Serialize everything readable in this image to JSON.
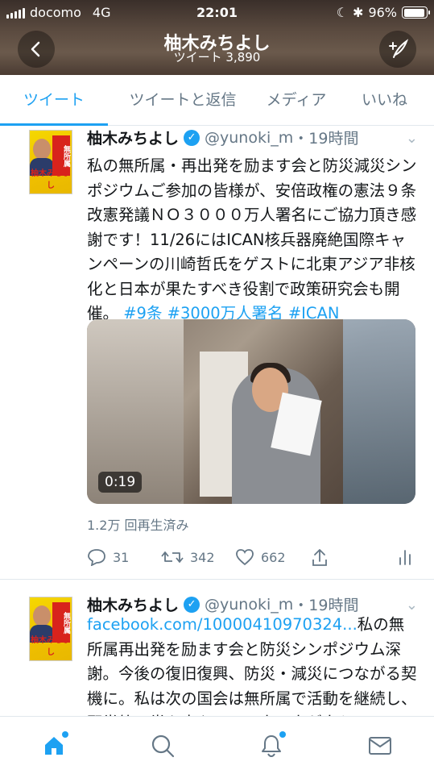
{
  "status_bar": {
    "carrier": "docomo",
    "network": "4G",
    "time": "22:01",
    "battery": "96%",
    "battery_level": 0.96
  },
  "profile_header": {
    "name": "柚木みちよし",
    "tweet_count": "ツイート 3,890"
  },
  "tabs": [
    {
      "label": "ツイート",
      "active": true
    },
    {
      "label": "ツイートと返信",
      "active": false
    },
    {
      "label": "メディア",
      "active": false
    },
    {
      "label": "いいね",
      "active": false
    }
  ],
  "tweets": [
    {
      "avatar": {
        "badge_text": "無所属",
        "name_text": "柚木みちよし"
      },
      "author": "柚木みちよし",
      "handle": "@yunoki_m",
      "time": "・19時間",
      "text": "私の無所属・再出発を励ます会と防災減災シンポジウムご参加の皆様が、安倍政権の憲法９条改憲発議ＮＯ３０００万人署名にご協力頂き感謝です！11/26にはICAN核兵器廃絶国際キャンペーンの川崎哲氏をゲストに北東アジア非核化と日本が果たすべき役割で政策研究会も開催。",
      "hashtags": [
        " #9条",
        " #3000万人署名",
        " #ICAN"
      ],
      "video_duration": "0:19",
      "views": "1.2万 回再生済み",
      "replies": "31",
      "retweets": "342",
      "likes": "662"
    },
    {
      "author": "柚木みちよし",
      "handle": "@yunoki_m",
      "time": "・19時間",
      "link": "facebook.com/10000410970324...",
      "text": "私の無所属再出発を励ます会と防災シンポジウム深謝。今後の復旧復興、防災・減災につながる契機に。私は次の国会は無所属で活動を継続し、野党第一党を中心に、一人一人が自らの"
    }
  ],
  "bottom_nav": {
    "items": [
      "home-icon",
      "search-icon",
      "notifications-icon",
      "messages-icon"
    ]
  },
  "colors": {
    "accent": "#1da1f2",
    "text": "#14171a",
    "secondary": "#657786"
  }
}
